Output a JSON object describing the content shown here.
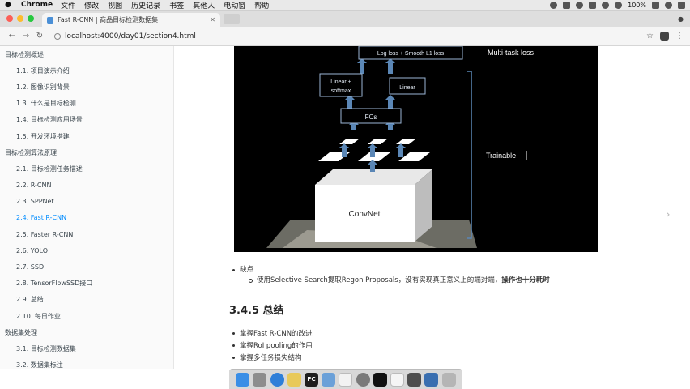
{
  "menubar": {
    "app_name": "Chrome",
    "menus": [
      "文件",
      "修改",
      "视图",
      "历史记录",
      "书签",
      "其他人",
      "电动窗",
      "帮助"
    ],
    "battery": "100%"
  },
  "browser": {
    "tab_title": "Fast R-CNN | 商品目标检测数据集",
    "url": "localhost:4000/day01/section4.html"
  },
  "sidebar": {
    "sections": [
      {
        "label": "目标检测概述",
        "level": 1
      },
      {
        "label": "1.1. 项目演示介绍",
        "level": 2
      },
      {
        "label": "1.2. 图像识别背景",
        "level": 2
      },
      {
        "label": "1.3. 什么是目标检测",
        "level": 2
      },
      {
        "label": "1.4. 目标检测应用场景",
        "level": 2
      },
      {
        "label": "1.5. 开发环境搭建",
        "level": 2
      },
      {
        "label": "目标检测算法原理",
        "level": 1
      },
      {
        "label": "2.1. 目标检测任务描述",
        "level": 2
      },
      {
        "label": "2.2. R-CNN",
        "level": 2
      },
      {
        "label": "2.3. SPPNet",
        "level": 2
      },
      {
        "label": "2.4. Fast R-CNN",
        "level": 2,
        "active": true
      },
      {
        "label": "2.5. Faster R-CNN",
        "level": 2
      },
      {
        "label": "2.6. YOLO",
        "level": 2
      },
      {
        "label": "2.7. SSD",
        "level": 2
      },
      {
        "label": "2.8. TensorFlowSSD接口",
        "level": 2
      },
      {
        "label": "2.9. 总结",
        "level": 2
      },
      {
        "label": "2.10. 每日作业",
        "level": 2
      },
      {
        "label": "数据集处理",
        "level": 1
      },
      {
        "label": "3.1. 目标检测数据集",
        "level": 2
      },
      {
        "label": "3.2. 数据集标注",
        "level": 2
      }
    ]
  },
  "figure": {
    "top_box": "Log loss + Smooth L1 loss",
    "multitask_label": "Multi-task loss",
    "softmax_box_line1": "Linear +",
    "softmax_box_line2": "softmax",
    "bbox_box": "Linear",
    "fcs_box": "FCs",
    "trainable_label": "Trainable",
    "convnet_label": "ConvNet"
  },
  "content": {
    "cons_title": "缺点",
    "cons_detail_a": "使用Selective Search提取Regon Proposals，没有实现真正意义上的端对端，",
    "cons_detail_b": "操作也十分耗时",
    "section_heading": "3.4.5 总结",
    "summary": [
      "掌握Fast R-CNN的改进",
      "掌握RoI pooling的作用",
      "掌握多任务损失结构"
    ]
  },
  "nav": {
    "prev": "‹",
    "next": "›"
  },
  "dock": [
    "Finder",
    "Launchpad",
    "Safari",
    "Notes",
    "PyCharm",
    "Mail",
    "Calendar",
    "Prefs",
    "Terminal",
    "TextEdit",
    "Dir",
    "Keynote",
    "Trash"
  ]
}
